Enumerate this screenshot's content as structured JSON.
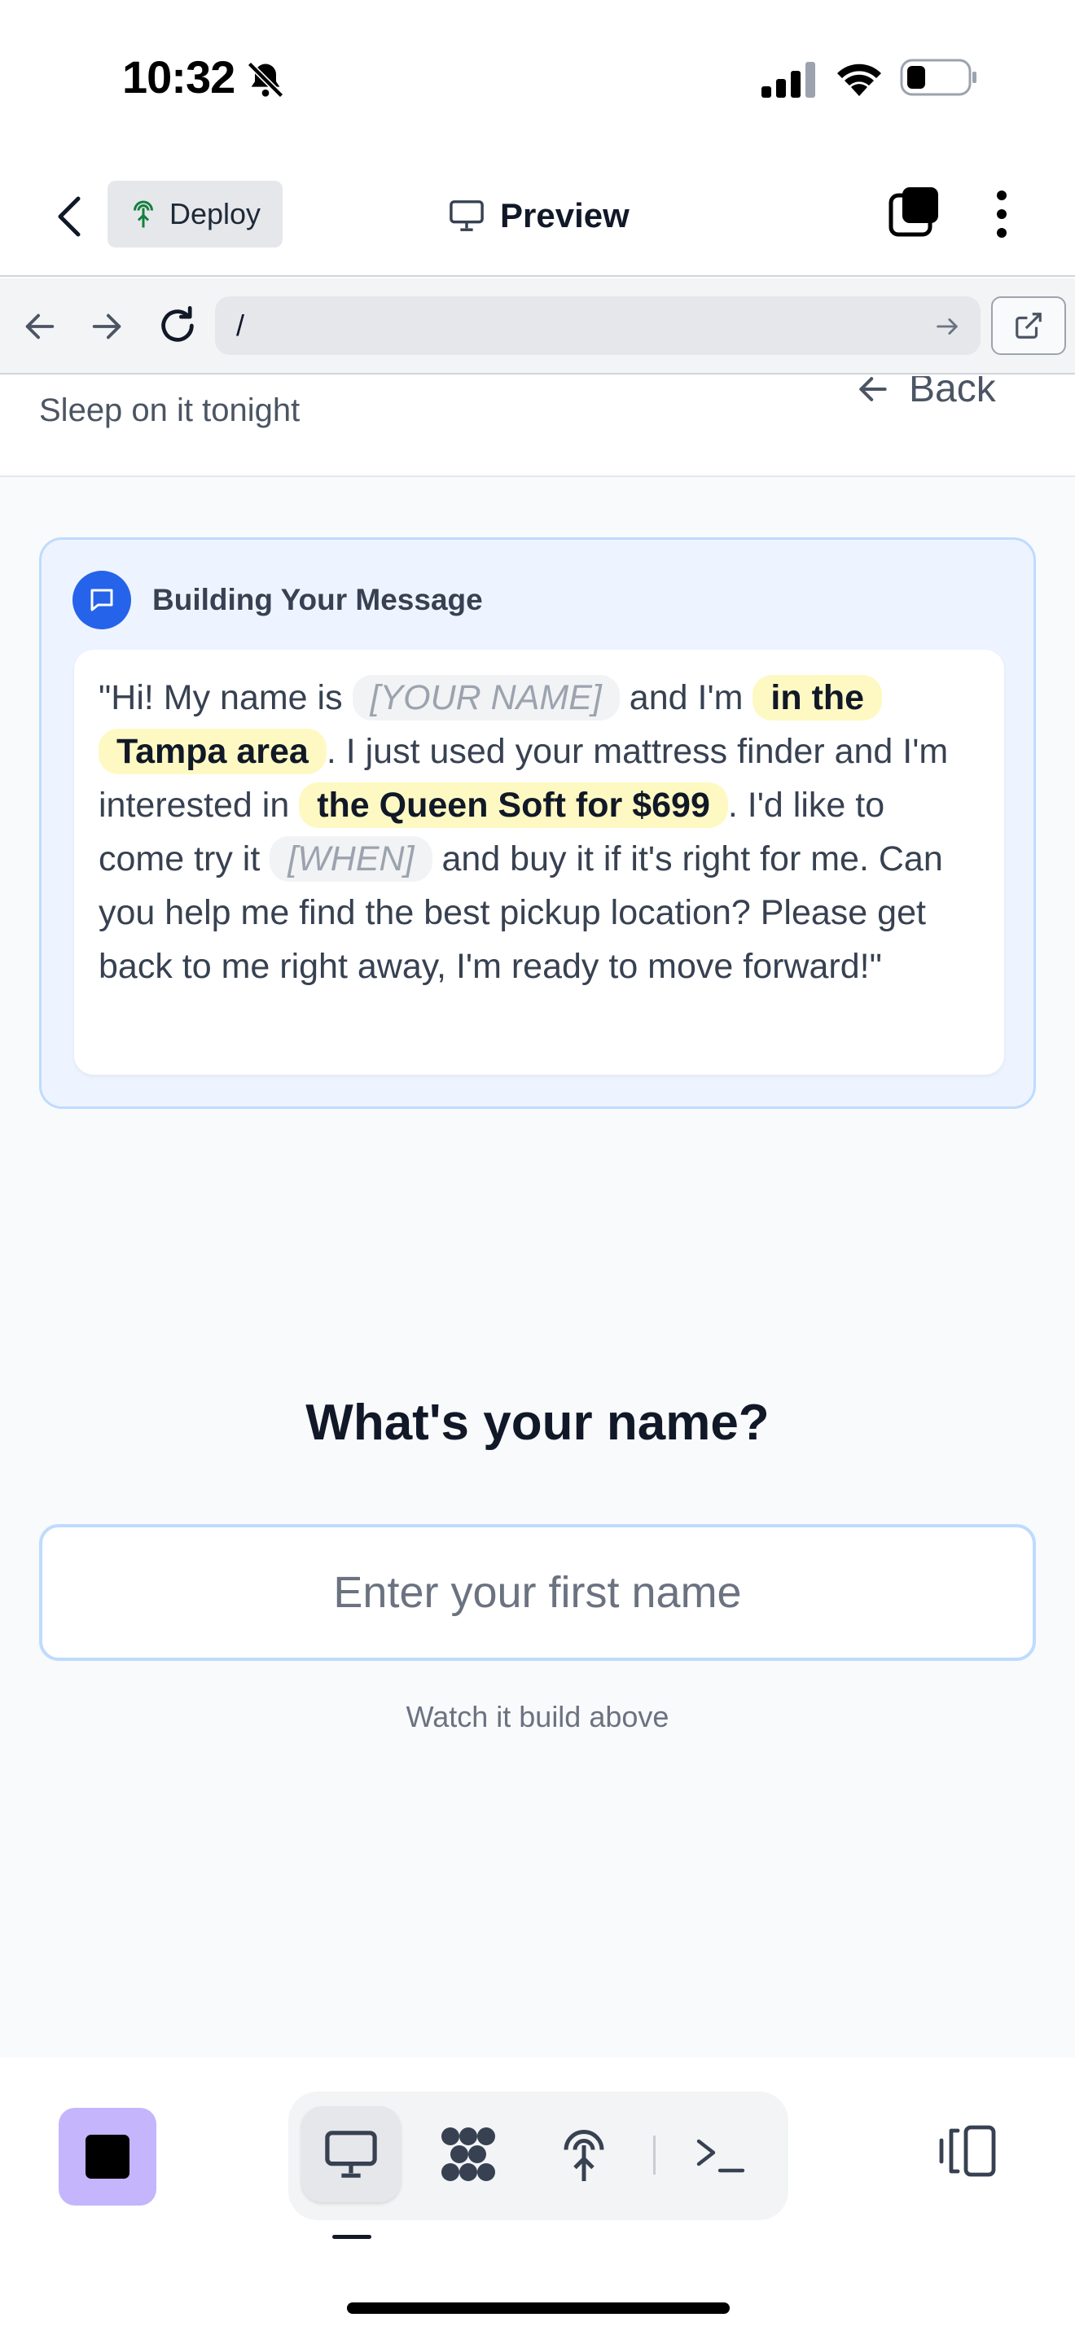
{
  "status_bar": {
    "time": "10:32"
  },
  "header": {
    "deploy_label": "Deploy",
    "preview_label": "Preview"
  },
  "browser": {
    "url": "/"
  },
  "page": {
    "subtitle": "Sleep on it tonight",
    "back_label": "Back",
    "message_card": {
      "title": "Building Your Message",
      "segments": {
        "s1": "\"Hi! My name is ",
        "name_placeholder": "[YOUR NAME]",
        "s2": " and I'm ",
        "location": "in the Tampa area",
        "s3": ". I just used your mattress finder and I'm interested in ",
        "product": "the Queen Soft for $699",
        "s4": ". I'd like to come try it ",
        "when_placeholder": "[WHEN]",
        "s5": " and buy it if it's right for me. Can you help me find the best pickup location? Please get back to me right away, I'm ready to move forward!\""
      }
    },
    "question": "What's your name?",
    "name_input": {
      "placeholder": "Enter your first name",
      "value": ""
    },
    "hint": "Watch it build above"
  },
  "toolbar": {
    "active_mode": "preview",
    "modes": [
      "preview-icon",
      "integrations-icon",
      "deploy-icon",
      "terminal-icon"
    ]
  },
  "colors": {
    "accent_blue": "#2563eb",
    "highlight_yellow": "#fef9c3",
    "stop_button_purple": "#c4b5fd"
  }
}
